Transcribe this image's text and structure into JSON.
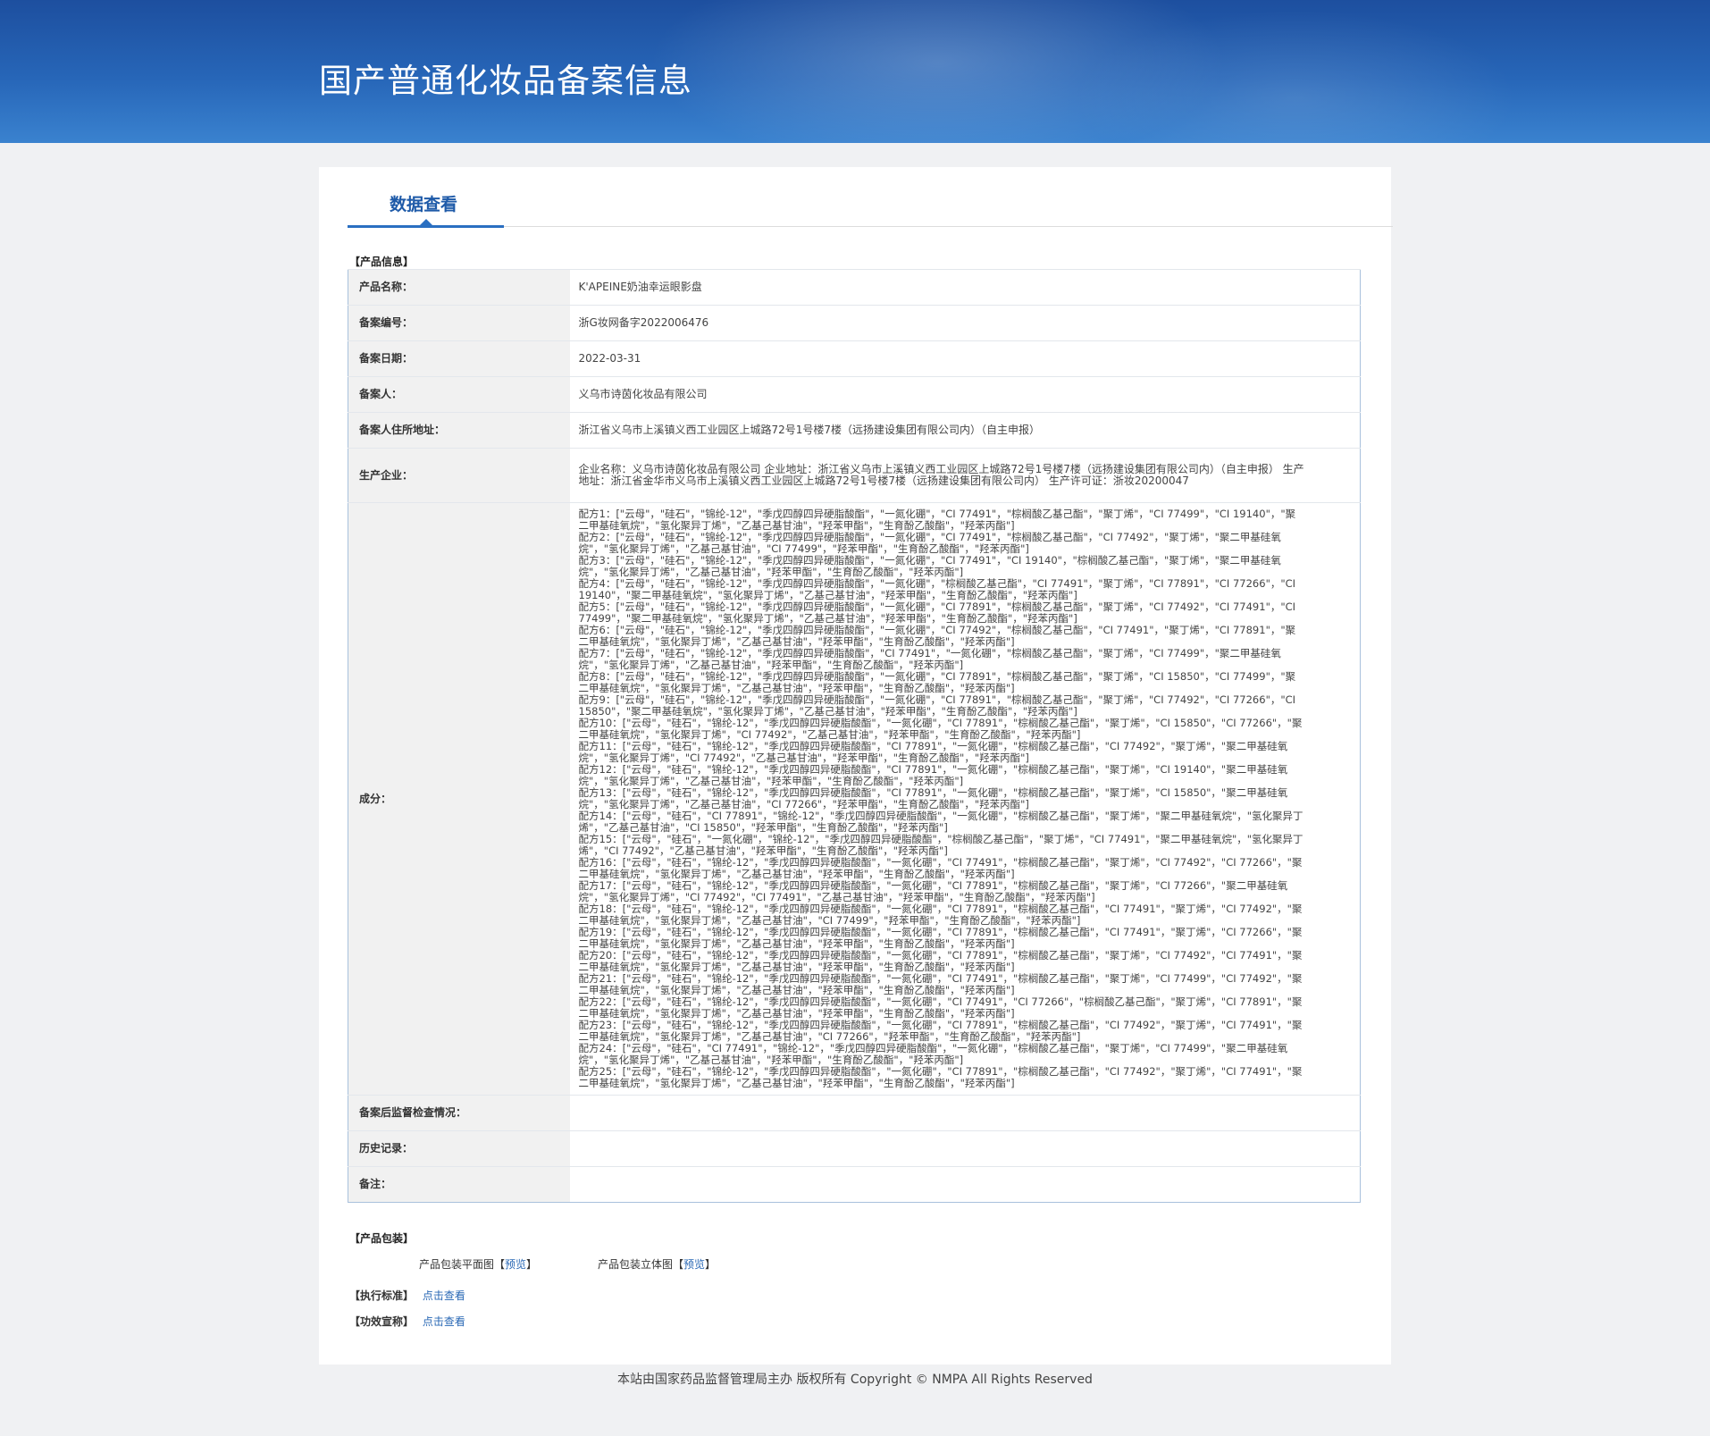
{
  "header": {
    "title": "国产普通化妆品备案信息"
  },
  "tab": {
    "label": "数据查看"
  },
  "sections": {
    "product_info": "【产品信息】",
    "packaging": "【产品包装】",
    "standard": "【执行标准】",
    "efficacy": "【功效宣称】"
  },
  "info": {
    "name_label": "产品名称：",
    "name_value": "K'APEINE奶油幸运眼影盘",
    "record_no_label": "备案编号：",
    "record_no_value": "浙G妆网备字2022006476",
    "record_date_label": "备案日期：",
    "record_date_value": "2022-03-31",
    "registrant_label": "备案人：",
    "registrant_value": "义乌市诗茵化妆品有限公司",
    "address_label": "备案人住所地址：",
    "address_value": "浙江省义乌市上溪镇义西工业园区上城路72号1号楼7楼（远扬建设集团有限公司内）（自主申报）",
    "manufacturer_label": "生产企业：",
    "manufacturer_value": "企业名称：义乌市诗茵化妆品有限公司 企业地址：浙江省义乌市上溪镇义西工业园区上城路72号1号楼7楼（远扬建设集团有限公司内）（自主申报） 生产地址：浙江省金华市义乌市上溪镇义西工业园区上城路72号1号楼7楼（远扬建设集团有限公司内） 生产许可证：浙妆20200047",
    "ingredients_label": "成分：",
    "ingredients": [
      "配方1：[\"云母\"，\"硅石\"，\"锦纶-12\"，\"季戊四醇四异硬脂酸酯\"，\"一氮化硼\"，\"CI 77491\"，\"棕榈酸乙基己酯\"，\"聚丁烯\"，\"CI 77499\"，\"CI 19140\"，\"聚二甲基硅氧烷\"，\"氢化聚异丁烯\"，\"乙基己基甘油\"，\"羟苯甲酯\"，\"生育酚乙酸酯\"，\"羟苯丙酯\"]",
      "配方2：[\"云母\"，\"硅石\"，\"锦纶-12\"，\"季戊四醇四异硬脂酸酯\"，\"一氮化硼\"，\"CI 77491\"，\"棕榈酸乙基己酯\"，\"CI 77492\"，\"聚丁烯\"，\"聚二甲基硅氧烷\"，\"氢化聚异丁烯\"，\"乙基己基甘油\"，\"CI 77499\"，\"羟苯甲酯\"，\"生育酚乙酸酯\"，\"羟苯丙酯\"]",
      "配方3：[\"云母\"，\"硅石\"，\"锦纶-12\"，\"季戊四醇四异硬脂酸酯\"，\"一氮化硼\"，\"CI 77491\"，\"CI 19140\"，\"棕榈酸乙基己酯\"，\"聚丁烯\"，\"聚二甲基硅氧烷\"，\"氢化聚异丁烯\"，\"乙基己基甘油\"，\"羟苯甲酯\"，\"生育酚乙酸酯\"，\"羟苯丙酯\"]",
      "配方4：[\"云母\"，\"硅石\"，\"锦纶-12\"，\"季戊四醇四异硬脂酸酯\"，\"一氮化硼\"，\"棕榈酸乙基己酯\"，\"CI 77491\"，\"聚丁烯\"，\"CI 77891\"，\"CI 77266\"，\"CI 19140\"，\"聚二甲基硅氧烷\"，\"氢化聚异丁烯\"，\"乙基己基甘油\"，\"羟苯甲酯\"，\"生育酚乙酸酯\"，\"羟苯丙酯\"]",
      "配方5：[\"云母\"，\"硅石\"，\"锦纶-12\"，\"季戊四醇四异硬脂酸酯\"，\"一氮化硼\"，\"CI 77891\"，\"棕榈酸乙基己酯\"，\"聚丁烯\"，\"CI 77492\"，\"CI 77491\"，\"CI 77499\"，\"聚二甲基硅氧烷\"，\"氢化聚异丁烯\"，\"乙基己基甘油\"，\"羟苯甲酯\"，\"生育酚乙酸酯\"，\"羟苯丙酯\"]",
      "配方6：[\"云母\"，\"硅石\"，\"锦纶-12\"，\"季戊四醇四异硬脂酸酯\"，\"一氮化硼\"，\"CI 77492\"，\"棕榈酸乙基己酯\"，\"CI 77491\"，\"聚丁烯\"，\"CI 77891\"，\"聚二甲基硅氧烷\"，\"氢化聚异丁烯\"，\"乙基己基甘油\"，\"羟苯甲酯\"，\"生育酚乙酸酯\"，\"羟苯丙酯\"]",
      "配方7：[\"云母\"，\"硅石\"，\"锦纶-12\"，\"季戊四醇四异硬脂酸酯\"，\"CI 77491\"，\"一氮化硼\"，\"棕榈酸乙基己酯\"，\"聚丁烯\"，\"CI 77499\"，\"聚二甲基硅氧烷\"，\"氢化聚异丁烯\"，\"乙基己基甘油\"，\"羟苯甲酯\"，\"生育酚乙酸酯\"，\"羟苯丙酯\"]",
      "配方8：[\"云母\"，\"硅石\"，\"锦纶-12\"，\"季戊四醇四异硬脂酸酯\"，\"一氮化硼\"，\"CI 77891\"，\"棕榈酸乙基己酯\"，\"聚丁烯\"，\"CI 15850\"，\"CI 77499\"，\"聚二甲基硅氧烷\"，\"氢化聚异丁烯\"，\"乙基己基甘油\"，\"羟苯甲酯\"，\"生育酚乙酸酯\"，\"羟苯丙酯\"]",
      "配方9：[\"云母\"，\"硅石\"，\"锦纶-12\"，\"季戊四醇四异硬脂酸酯\"，\"一氮化硼\"，\"CI 77891\"，\"棕榈酸乙基己酯\"，\"聚丁烯\"，\"CI 77492\"，\"CI 77266\"，\"CI 15850\"，\"聚二甲基硅氧烷\"，\"氢化聚异丁烯\"，\"乙基己基甘油\"，\"羟苯甲酯\"，\"生育酚乙酸酯\"，\"羟苯丙酯\"]",
      "配方10：[\"云母\"，\"硅石\"，\"锦纶-12\"，\"季戊四醇四异硬脂酸酯\"，\"一氮化硼\"，\"CI 77891\"，\"棕榈酸乙基己酯\"，\"聚丁烯\"，\"CI 15850\"，\"CI 77266\"，\"聚二甲基硅氧烷\"，\"氢化聚异丁烯\"，\"CI 77492\"，\"乙基己基甘油\"，\"羟苯甲酯\"，\"生育酚乙酸酯\"，\"羟苯丙酯\"]",
      "配方11：[\"云母\"，\"硅石\"，\"锦纶-12\"，\"季戊四醇四异硬脂酸酯\"，\"CI 77891\"，\"一氮化硼\"，\"棕榈酸乙基己酯\"，\"CI 77492\"，\"聚丁烯\"，\"聚二甲基硅氧烷\"，\"氢化聚异丁烯\"，\"CI 77492\"，\"乙基己基甘油\"，\"羟苯甲酯\"，\"生育酚乙酸酯\"，\"羟苯丙酯\"]",
      "配方12：[\"云母\"，\"硅石\"，\"锦纶-12\"，\"季戊四醇四异硬脂酸酯\"，\"CI 77891\"，\"一氮化硼\"，\"棕榈酸乙基己酯\"，\"聚丁烯\"，\"CI 19140\"，\"聚二甲基硅氧烷\"，\"氢化聚异丁烯\"，\"乙基己基甘油\"，\"羟苯甲酯\"，\"生育酚乙酸酯\"，\"羟苯丙酯\"]",
      "配方13：[\"云母\"，\"硅石\"，\"锦纶-12\"，\"季戊四醇四异硬脂酸酯\"，\"CI 77891\"，\"一氮化硼\"，\"棕榈酸乙基己酯\"，\"聚丁烯\"，\"CI 15850\"，\"聚二甲基硅氧烷\"，\"氢化聚异丁烯\"，\"乙基己基甘油\"，\"CI 77266\"，\"羟苯甲酯\"，\"生育酚乙酸酯\"，\"羟苯丙酯\"]",
      "配方14：[\"云母\"，\"硅石\"，\"CI 77891\"，\"锦纶-12\"，\"季戊四醇四异硬脂酸酯\"，\"一氮化硼\"，\"棕榈酸乙基己酯\"，\"聚丁烯\"，\"聚二甲基硅氧烷\"，\"氢化聚异丁烯\"，\"乙基己基甘油\"，\"CI 15850\"，\"羟苯甲酯\"，\"生育酚乙酸酯\"，\"羟苯丙酯\"]",
      "配方15：[\"云母\"，\"硅石\"，\"一氮化硼\"，\"锦纶-12\"，\"季戊四醇四异硬脂酸酯\"，\"棕榈酸乙基己酯\"，\"聚丁烯\"，\"CI 77491\"，\"聚二甲基硅氧烷\"，\"氢化聚异丁烯\"，\"CI 77492\"，\"乙基己基甘油\"，\"羟苯甲酯\"，\"生育酚乙酸酯\"，\"羟苯丙酯\"]",
      "配方16：[\"云母\"，\"硅石\"，\"锦纶-12\"，\"季戊四醇四异硬脂酸酯\"，\"一氮化硼\"，\"CI 77491\"，\"棕榈酸乙基己酯\"，\"聚丁烯\"，\"CI 77492\"，\"CI 77266\"，\"聚二甲基硅氧烷\"，\"氢化聚异丁烯\"，\"乙基己基甘油\"，\"羟苯甲酯\"，\"生育酚乙酸酯\"，\"羟苯丙酯\"]",
      "配方17：[\"云母\"，\"硅石\"，\"锦纶-12\"，\"季戊四醇四异硬脂酸酯\"，\"一氮化硼\"，\"CI 77891\"，\"棕榈酸乙基己酯\"，\"聚丁烯\"，\"CI 77266\"，\"聚二甲基硅氧烷\"，\"氢化聚异丁烯\"，\"CI 77492\"，\"CI 77491\"，\"乙基己基甘油\"，\"羟苯甲酯\"，\"生育酚乙酸酯\"，\"羟苯丙酯\"]",
      "配方18：[\"云母\"，\"硅石\"，\"锦纶-12\"，\"季戊四醇四异硬脂酸酯\"，\"一氮化硼\"，\"CI 77891\"，\"棕榈酸乙基己酯\"，\"CI 77491\"，\"聚丁烯\"，\"CI 77492\"，\"聚二甲基硅氧烷\"，\"氢化聚异丁烯\"，\"乙基己基甘油\"，\"CI 77499\"，\"羟苯甲酯\"，\"生育酚乙酸酯\"，\"羟苯丙酯\"]",
      "配方19：[\"云母\"，\"硅石\"，\"锦纶-12\"，\"季戊四醇四异硬脂酸酯\"，\"一氮化硼\"，\"CI 77891\"，\"棕榈酸乙基己酯\"，\"CI 77491\"，\"聚丁烯\"，\"CI 77266\"，\"聚二甲基硅氧烷\"，\"氢化聚异丁烯\"，\"乙基己基甘油\"，\"羟苯甲酯\"，\"生育酚乙酸酯\"，\"羟苯丙酯\"]",
      "配方20：[\"云母\"，\"硅石\"，\"锦纶-12\"，\"季戊四醇四异硬脂酸酯\"，\"一氮化硼\"，\"CI 77891\"，\"棕榈酸乙基己酯\"，\"聚丁烯\"，\"CI 77492\"，\"CI 77491\"，\"聚二甲基硅氧烷\"，\"氢化聚异丁烯\"，\"乙基己基甘油\"，\"羟苯甲酯\"，\"生育酚乙酸酯\"，\"羟苯丙酯\"]",
      "配方21：[\"云母\"，\"硅石\"，\"锦纶-12\"，\"季戊四醇四异硬脂酸酯\"，\"一氮化硼\"，\"CI 77491\"，\"棕榈酸乙基己酯\"，\"聚丁烯\"，\"CI 77499\"，\"CI 77492\"，\"聚二甲基硅氧烷\"，\"氢化聚异丁烯\"，\"乙基己基甘油\"，\"羟苯甲酯\"，\"生育酚乙酸酯\"，\"羟苯丙酯\"]",
      "配方22：[\"云母\"，\"硅石\"，\"锦纶-12\"，\"季戊四醇四异硬脂酸酯\"，\"一氮化硼\"，\"CI 77491\"，\"CI 77266\"，\"棕榈酸乙基己酯\"，\"聚丁烯\"，\"CI 77891\"，\"聚二甲基硅氧烷\"，\"氢化聚异丁烯\"，\"乙基己基甘油\"，\"羟苯甲酯\"，\"生育酚乙酸酯\"，\"羟苯丙酯\"]",
      "配方23：[\"云母\"，\"硅石\"，\"锦纶-12\"，\"季戊四醇四异硬脂酸酯\"，\"一氮化硼\"，\"CI 77891\"，\"棕榈酸乙基己酯\"，\"CI 77492\"，\"聚丁烯\"，\"CI 77491\"，\"聚二甲基硅氧烷\"，\"氢化聚异丁烯\"，\"乙基己基甘油\"，\"CI 77266\"，\"羟苯甲酯\"，\"生育酚乙酸酯\"，\"羟苯丙酯\"]",
      "配方24：[\"云母\"，\"硅石\"，\"CI 77491\"，\"锦纶-12\"，\"季戊四醇四异硬脂酸酯\"，\"一氮化硼\"，\"棕榈酸乙基己酯\"，\"聚丁烯\"，\"CI 77499\"，\"聚二甲基硅氧烷\"，\"氢化聚异丁烯\"，\"乙基己基甘油\"，\"羟苯甲酯\"，\"生育酚乙酸酯\"，\"羟苯丙酯\"]",
      "配方25：[\"云母\"，\"硅石\"，\"锦纶-12\"，\"季戊四醇四异硬脂酸酯\"，\"一氮化硼\"，\"CI 77891\"，\"棕榈酸乙基己酯\"，\"CI 77492\"，\"聚丁烯\"，\"CI 77491\"，\"聚二甲基硅氧烷\"，\"氢化聚异丁烯\"，\"乙基己基甘油\"，\"羟苯甲酯\"，\"生育酚乙酸酯\"，\"羟苯丙酯\"]"
    ],
    "supervision_label": "备案后监督检查情况：",
    "supervision_value": "",
    "history_label": "历史记录：",
    "history_value": "",
    "remarks_label": "备注：",
    "remarks_value": ""
  },
  "packaging": {
    "flat_label": "产品包装平面图",
    "flat_link": "预览",
    "stereo_label": "产品包装立体图",
    "stereo_link": "预览",
    "bracket_open": "【",
    "bracket_close": "】"
  },
  "links": {
    "standard_link": "点击查看",
    "efficacy_link": "点击查看"
  },
  "footer": {
    "text": "本站由国家药品监督管理局主办 版权所有 Copyright © NMPA All Rights Reserved"
  }
}
